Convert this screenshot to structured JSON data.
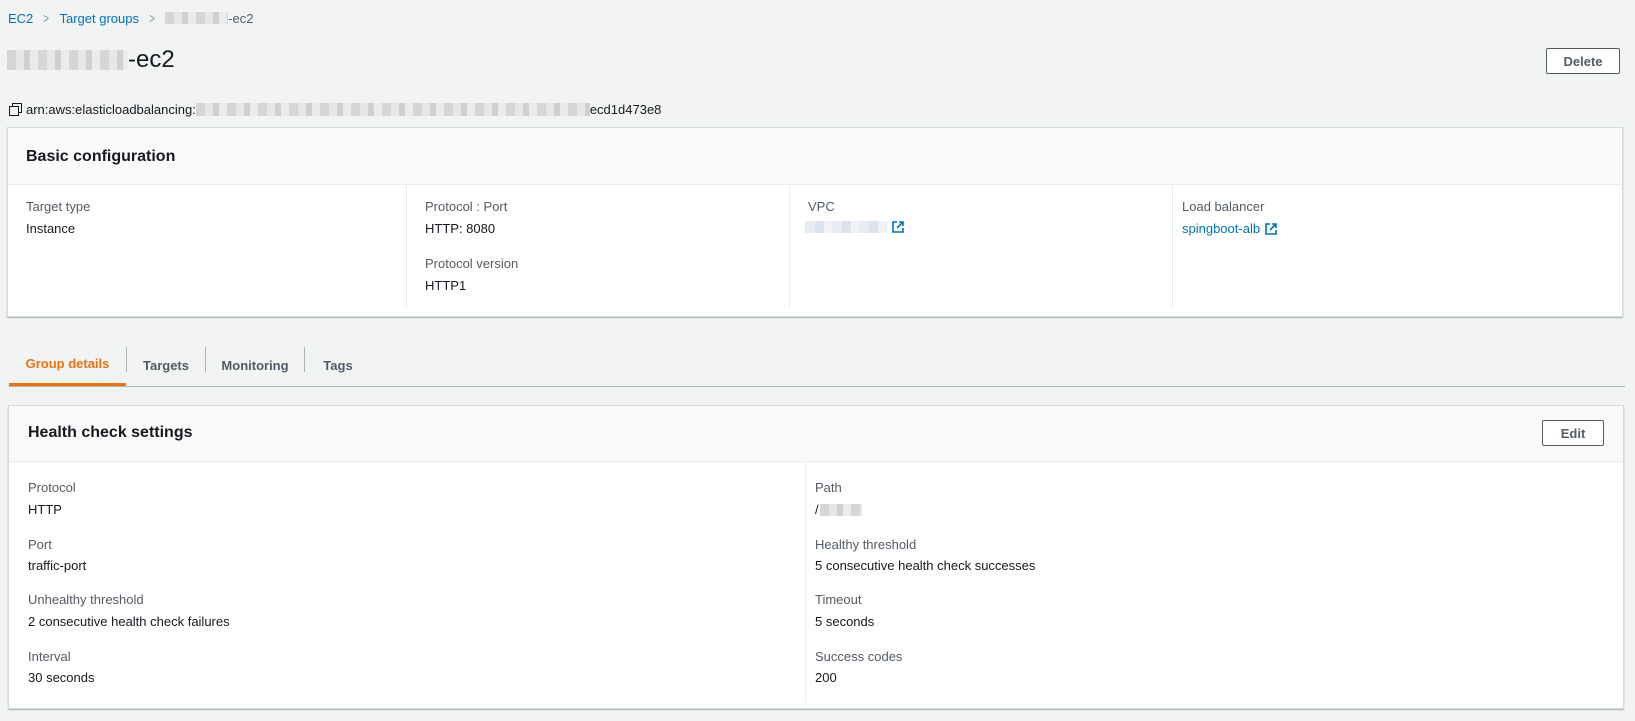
{
  "breadcrumb": {
    "items": [
      "EC2",
      "Target groups"
    ],
    "current_suffix": "-ec2"
  },
  "page": {
    "title_suffix": "-ec2",
    "delete_label": "Delete",
    "arn_prefix": "arn:aws:elasticloadbalancing:",
    "arn_suffix": "ecd1d473e8"
  },
  "basic_configuration": {
    "title": "Basic configuration",
    "target_type_label": "Target type",
    "target_type_value": "Instance",
    "protocol_port_label": "Protocol : Port",
    "protocol_port_value": "HTTP: 8080",
    "protocol_version_label": "Protocol version",
    "protocol_version_value": "HTTP1",
    "vpc_label": "VPC",
    "load_balancer_label": "Load balancer",
    "load_balancer_value": "spingboot-alb"
  },
  "tabs": [
    "Group details",
    "Targets",
    "Monitoring",
    "Tags"
  ],
  "health_check": {
    "title": "Health check settings",
    "edit_label": "Edit",
    "protocol_label": "Protocol",
    "protocol_value": "HTTP",
    "port_label": "Port",
    "port_value": "traffic-port",
    "unhealthy_label": "Unhealthy threshold",
    "unhealthy_value": "2 consecutive health check failures",
    "interval_label": "Interval",
    "interval_value": "30 seconds",
    "path_label": "Path",
    "path_prefix": "/",
    "healthy_label": "Healthy threshold",
    "healthy_value": "5 consecutive health check successes",
    "timeout_label": "Timeout",
    "timeout_value": "5 seconds",
    "success_codes_label": "Success codes",
    "success_codes_value": "200"
  },
  "colors": {
    "link": "#0073bb",
    "active_tab": "#ec7211",
    "background": "#f2f3f3"
  }
}
